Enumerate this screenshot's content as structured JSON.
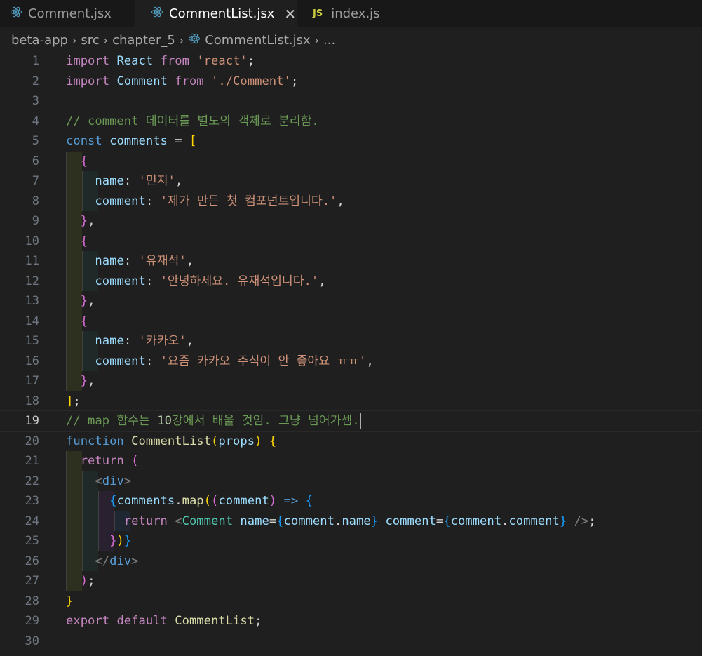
{
  "tabs": [
    {
      "label": "Comment.jsx",
      "icon": "react-icon"
    },
    {
      "label": "CommentList.jsx",
      "icon": "react-icon",
      "active": true,
      "close": "✕"
    },
    {
      "label": "index.js",
      "icon": "js-icon",
      "badge": "JS"
    }
  ],
  "breadcrumb": [
    "beta-app",
    "src",
    "chapter_5",
    "CommentList.jsx",
    "..."
  ],
  "active_line": 19,
  "code_lines": [
    "import React from 'react';",
    "import Comment from './Comment';",
    "",
    "// comment 데이터를 별도의 객체로 분리함.",
    "const comments = [",
    "  {",
    "    name: '민지',",
    "    comment: '제가 만든 첫 컴포넌트입니다.',",
    "  },",
    "  {",
    "    name: '유재석',",
    "    comment: '안녕하세요. 유재석입니다.',",
    "  },",
    "  {",
    "    name: '카카오',",
    "    comment: '요즘 카카오 주식이 안 좋아요 ㅠㅠ',",
    "  },",
    "];",
    "// map 함수는 10강에서 배울 것임. 그냥 넘어가셈.",
    "function CommentList(props) {",
    "  return (",
    "    <div>",
    "      {comments.map((comment) => {",
    "        return <Comment name={comment.name} comment={comment.comment} />;",
    "      })}",
    "    </div>",
    "  );",
    "}",
    "export default CommentList;",
    ""
  ],
  "colors": {
    "background": "#1f1f1f",
    "keyword": "#c586c0",
    "string": "#ce9178",
    "comment": "#6a9955"
  }
}
